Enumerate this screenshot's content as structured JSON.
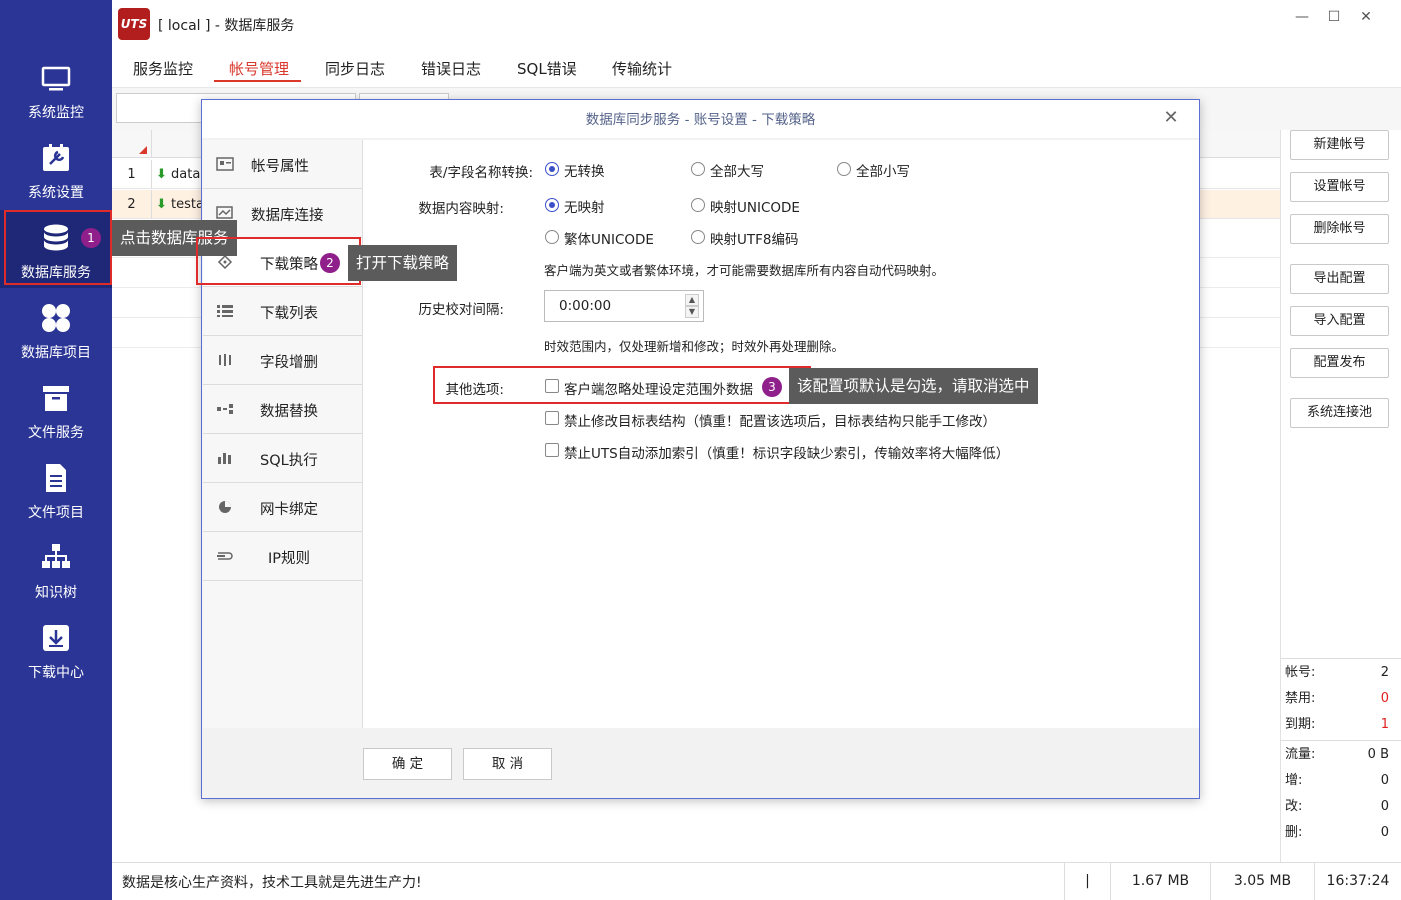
{
  "window": {
    "title": "[ local ] - 数据库服务",
    "logo_text": "UTS"
  },
  "nav": [
    {
      "id": "monitor",
      "label": "系统监控",
      "icon": "monitor-icon"
    },
    {
      "id": "settings",
      "label": "系统设置",
      "icon": "settings-icon"
    },
    {
      "id": "db-service",
      "label": "数据库服务",
      "icon": "database-icon"
    },
    {
      "id": "db-project",
      "label": "数据库项目",
      "icon": "grid-icon"
    },
    {
      "id": "file-service",
      "label": "文件服务",
      "icon": "folder-icon"
    },
    {
      "id": "file-project",
      "label": "文件项目",
      "icon": "document-icon"
    },
    {
      "id": "knowledge",
      "label": "知识树",
      "icon": "tree-icon"
    },
    {
      "id": "download",
      "label": "下载中心",
      "icon": "download-icon"
    }
  ],
  "tabs": [
    "服务监控",
    "帐号管理",
    "同步日志",
    "错误日志",
    "SQL错误",
    "传输统计"
  ],
  "grid": {
    "rows": [
      {
        "num": "1",
        "name": "data"
      },
      {
        "num": "2",
        "name": "testa"
      }
    ]
  },
  "right_buttons": [
    "新建帐号",
    "设置帐号",
    "删除帐号",
    "导出配置",
    "导入配置",
    "配置发布",
    "系统连接池"
  ],
  "stats": [
    {
      "label": "帐号:",
      "value": "2",
      "red": false
    },
    {
      "label": "禁用:",
      "value": "0",
      "red": true
    },
    {
      "label": "到期:",
      "value": "1",
      "red": true
    },
    {
      "label": "流量:",
      "value": "0 B",
      "red": false
    },
    {
      "label": "增:",
      "value": "0",
      "red": false
    },
    {
      "label": "改:",
      "value": "0",
      "red": false
    },
    {
      "label": "删:",
      "value": "0",
      "red": false
    }
  ],
  "statusbar": {
    "message": "数据是核心生产资料，技术工具就是先进生产力!",
    "sep": "|",
    "mem1": "1.67 MB",
    "mem2": "3.05 MB",
    "time": "16:37:24"
  },
  "dialog": {
    "title": "数据库同步服务 - 账号设置 - 下载策略",
    "menu": [
      {
        "label": "帐号属性",
        "icon": "card-icon"
      },
      {
        "label": "数据库连接",
        "icon": "connection-icon"
      },
      {
        "label": "下载策略",
        "icon": "strategy-icon"
      },
      {
        "label": "下载列表",
        "icon": "list-icon"
      },
      {
        "label": "字段增删",
        "icon": "columns-icon"
      },
      {
        "label": "数据替换",
        "icon": "replace-icon"
      },
      {
        "label": "SQL执行",
        "icon": "bar-icon"
      },
      {
        "label": "网卡绑定",
        "icon": "pie-icon"
      },
      {
        "label": "IP规则",
        "icon": "rule-icon"
      }
    ],
    "name_conversion": {
      "label": "表/字段名称转换:",
      "options": [
        "无转换",
        "全部大写",
        "全部小写"
      ],
      "selected": 0
    },
    "content_mapping": {
      "label": "数据内容映射:",
      "options": [
        "无映射",
        "映射UNICODE",
        "繁体UNICODE",
        "映射UTF8编码"
      ],
      "selected": 0,
      "note": "客户端为英文或者繁体环境，才可能需要数据库所有内容自动代码映射。"
    },
    "history": {
      "label": "历史校对间隔:",
      "value": "0:00:00",
      "note": "时效范围内，仅处理新增和修改；时效外再处理删除。"
    },
    "other": {
      "label": "其他选项:",
      "options": [
        {
          "label": "客户端忽略处理设定范围外数据",
          "checked": false
        },
        {
          "label": "禁止修改目标表结构（慎重！配置该选项后，目标表结构只能手工修改）",
          "checked": false
        },
        {
          "label": "禁止UTS自动添加索引（慎重！标识字段缺少索引，传输效率将大幅降低）",
          "checked": false
        }
      ]
    },
    "ok": "确 定",
    "cancel": "取 消"
  },
  "annotations": {
    "tip1": "点击数据库服务",
    "tip2": "打开下载策略",
    "tip3": "该配置项默认是勾选，请取消选中",
    "badge1": "1",
    "badge2": "2",
    "badge3": "3"
  }
}
